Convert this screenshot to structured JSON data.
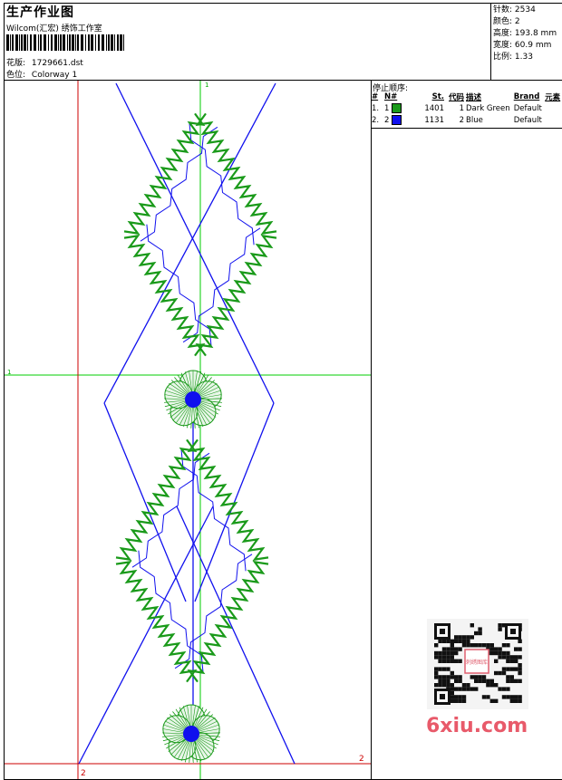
{
  "header": {
    "title": "生产作业图",
    "company": "Wilcom(汇宏) 绣饰工作室",
    "design_label": "花版:",
    "design_value": "1729661.dst",
    "colorway_label": "色位:",
    "colorway_value": "Colorway 1"
  },
  "stats": {
    "stitches_label": "针数:",
    "stitches_value": "2534",
    "colors_label": "颜色:",
    "colors_value": "2",
    "height_label": "高度:",
    "height_value": "193.8 mm",
    "width_label": "宽度:",
    "width_value": "60.9 mm",
    "scale_label": "比例:",
    "scale_value": "1.33"
  },
  "stop_sequence": {
    "title": "停止顺序:",
    "headers": [
      "#",
      "N#",
      "St.",
      "代码",
      "描述",
      "Brand",
      "元素"
    ],
    "rows": [
      {
        "num": "1.",
        "n": "1",
        "color": "#1a9a1a",
        "stitches": "1401",
        "code": "1",
        "desc": "Dark Green",
        "brand": "Default",
        "element": ""
      },
      {
        "num": "2.",
        "n": "2",
        "color": "#1010ee",
        "stitches": "1131",
        "code": "2",
        "desc": "Blue",
        "brand": "Default",
        "element": ""
      }
    ]
  },
  "canvas": {
    "marker_top": "1",
    "marker_left": "1",
    "marker_right": "2",
    "marker_bottom": "2",
    "green_color": "#1a9a1a",
    "blue_color": "#1010ee",
    "guide_green": "#00cc00",
    "guide_red": "#cc0000"
  },
  "watermark": {
    "text": "6xiu.com",
    "stamp": "刺绣图库"
  }
}
